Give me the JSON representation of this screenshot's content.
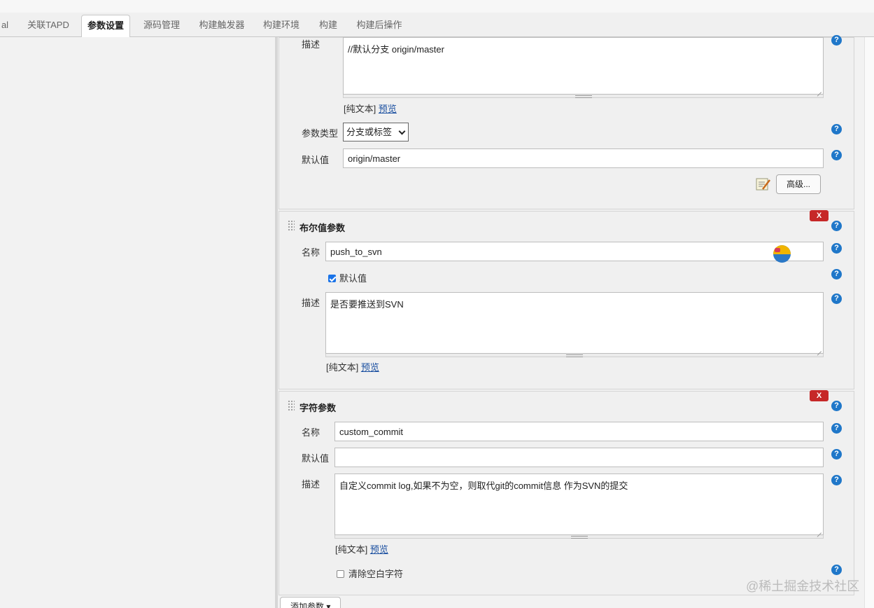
{
  "tabs": [
    {
      "label": "al"
    },
    {
      "label": "关联TAPD"
    },
    {
      "label": "参数设置"
    },
    {
      "label": "源码管理"
    },
    {
      "label": "构建触发器"
    },
    {
      "label": "构建环境"
    },
    {
      "label": "构建"
    },
    {
      "label": "构建后操作"
    }
  ],
  "active_tab": "参数设置",
  "common": {
    "name_label": "名称",
    "desc_label": "描述",
    "default_label": "默认值",
    "type_label": "参数类型",
    "plain_text": "[纯文本]",
    "preview": "预览",
    "help": "?",
    "delete": "X"
  },
  "git_param": {
    "description": "//默认分支 origin/master",
    "type_value": "分支或标签",
    "default_value": "origin/master",
    "advanced_label": "高级..."
  },
  "bool_param": {
    "title": "布尔值参数",
    "name": "push_to_svn",
    "default_checked": true,
    "default_label": "默认值",
    "description": "是否要推送到SVN"
  },
  "string_param": {
    "title": "字符参数",
    "name": "custom_commit",
    "default_value": "",
    "description": "自定义commit log,如果不为空，则取代git的commit信息 作为SVN的提交",
    "trim_label": "清除空白字符",
    "trim_checked": false
  },
  "add_param_label": "添加参数 ▾",
  "watermark": "@稀土掘金技术社区",
  "colors": {
    "help_blue": "#1f77c9",
    "delete_red": "#c62828",
    "link_blue": "#1a4fa0"
  }
}
